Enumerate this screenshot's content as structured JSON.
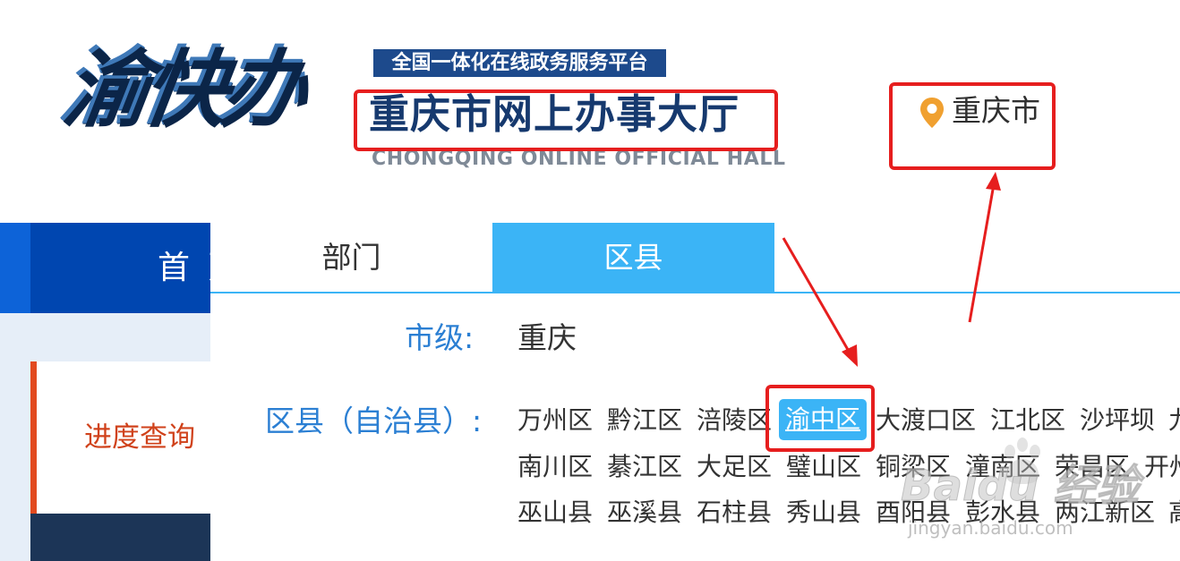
{
  "header": {
    "logo_text": "渝快办",
    "slogan": "全国一体化在线政务服务平台",
    "hall_title": "重庆市网上办事大厅",
    "hall_title_en": "CHONGQING ONLINE OFFICIAL HALL",
    "location_icon": "map-pin-icon",
    "city": "重庆市"
  },
  "nav": {
    "home_label": "首页",
    "side_item_label": "进度查询"
  },
  "dropdown": {
    "tabs": [
      {
        "label": "部门",
        "active": false
      },
      {
        "label": "区县",
        "active": true
      }
    ],
    "city_level_label": "市级:",
    "city_level_value": "重庆",
    "district_label": "区县（自治县）:",
    "selected_district": "渝中区",
    "districts_row1": [
      "万州区",
      "黔江区",
      "涪陵区",
      "渝中区",
      "大渡口区",
      "江北区",
      "沙坪坝",
      "九"
    ],
    "districts_row2": [
      "南川区",
      "綦江区",
      "大足区",
      "璧山区",
      "铜梁区",
      "潼南区",
      "荣昌区",
      "开州"
    ],
    "districts_row3": [
      "巫山县",
      "巫溪县",
      "石柱县",
      "秀山县",
      "酉阳县",
      "彭水县",
      "两江新区",
      "高"
    ]
  },
  "watermark": {
    "text": "Baidu 经验",
    "url": "jingyan.baidu.com"
  },
  "colors": {
    "accent_blue": "#3bb4f6",
    "nav_blue": "#0046b0",
    "title_navy": "#16396e",
    "annotation_red": "#e61e1e",
    "side_red": "#d0421b",
    "pin_orange": "#f0a030"
  }
}
